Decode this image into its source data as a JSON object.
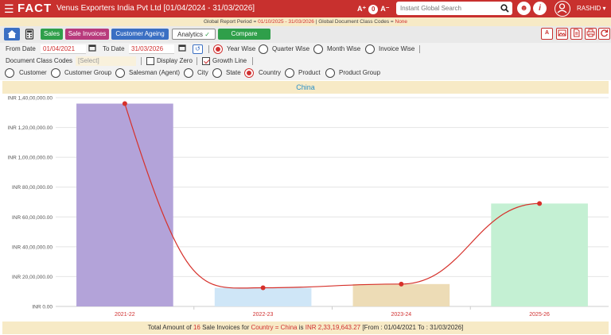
{
  "header": {
    "logo": "FACT",
    "company": "Venus Exporters India Pvt Ltd [01/04/2024 - 31/03/2026]",
    "font_ctl": [
      "A⁺",
      "0",
      "A⁻"
    ],
    "search_placeholder": "Instant Global Search",
    "user": "RASHID",
    "colors": {
      "brand": "#c8302e"
    }
  },
  "infobar": {
    "period_label": "Global Report Period = ",
    "period_value": "01/10/2025 - 31/03/2026",
    "sep": " | ",
    "doc_label": "Global Document Class Codes = ",
    "doc_value": "None"
  },
  "toolbar": {
    "sales": "Sales",
    "sale_invoices": "Sale Invoices",
    "customer_ageing": "Customer Ageing",
    "analytics": "Analytics",
    "compare": "Compare"
  },
  "filters": {
    "from_date_label": "From Date",
    "from_date": "01/04/2021",
    "to_date_label": "To Date",
    "to_date": "31/03/2026",
    "periods": [
      "Year Wise",
      "Quarter Wise",
      "Month Wise",
      "Invoice Wise"
    ],
    "doc_class_label": "Document Class Codes",
    "doc_class_placeholder": "[Select]",
    "display_zero": "Display Zero",
    "growth_line": "Growth Line",
    "dimensions": [
      "Customer",
      "Customer Group",
      "Salesman (Agent)",
      "City",
      "State",
      "Country",
      "Product",
      "Product Group"
    ]
  },
  "chart_data": {
    "type": "bar",
    "title": "China",
    "categories": [
      "2021-22",
      "2022-23",
      "2023-24",
      "2025-26"
    ],
    "values": [
      13600000,
      1250000,
      1500000,
      6900000
    ],
    "growth_line": true,
    "ylim": [
      0,
      14000000
    ],
    "yticks": [
      "INR 0.00",
      "INR 20,00,000.00",
      "INR 40,00,000.00",
      "INR 60,00,000.00",
      "INR 80,00,000.00",
      "INR 1,00,00,000.00",
      "INR 1,20,00,000.00",
      "INR 1,40,00,000.00"
    ],
    "bar_colors": [
      "#b3a3d9",
      "#cfe6f7",
      "#eddcb6",
      "#c4f0d3"
    ],
    "line_color": "#d6312b",
    "grid": true
  },
  "footer": {
    "p1": "Total Amount of ",
    "count": "16",
    "p2": " Sale Invoices for ",
    "filter": "Country = China",
    "p3": " is ",
    "amount": "INR 2,33,19,643.27",
    "p4": " [From : 01/04/2021 To : 31/03/2026]"
  }
}
